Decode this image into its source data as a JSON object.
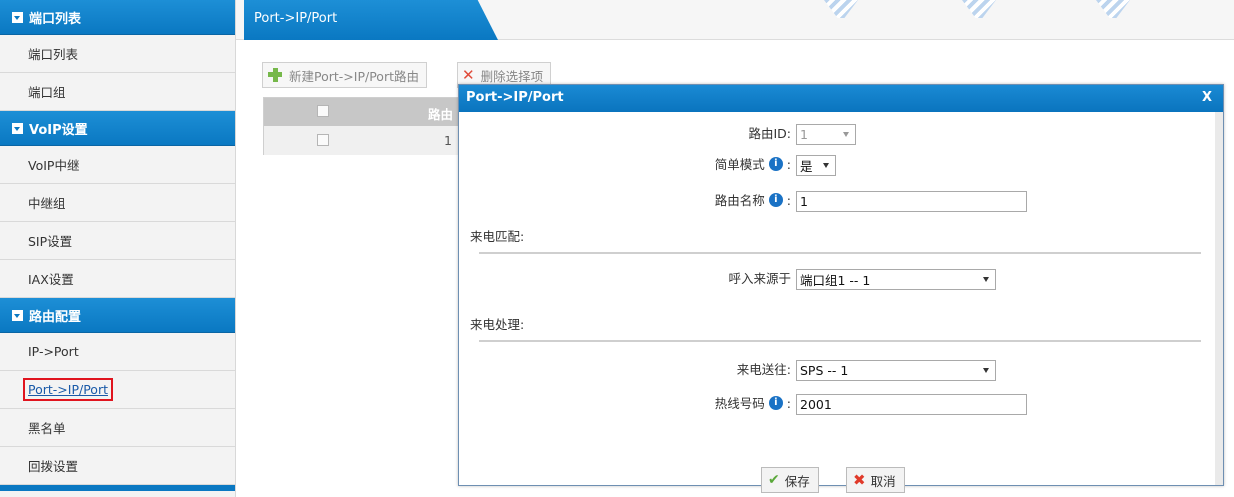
{
  "sidebar": {
    "sections": [
      {
        "title": "端口列表",
        "items": [
          "端口列表",
          "端口组"
        ]
      },
      {
        "title": "VoIP设置",
        "items": [
          "VoIP中继",
          "中继组",
          "SIP设置",
          "IAX设置"
        ]
      },
      {
        "title": "路由配置",
        "items": [
          "IP->Port",
          "Port->IP/Port",
          "黑名单",
          "回拨设置"
        ]
      }
    ],
    "active_item": "Port->IP/Port"
  },
  "tab": {
    "label": "Port->IP/Port"
  },
  "toolbar": {
    "new_label": "新建Port->IP/Port路由",
    "delete_label": "删除选择项"
  },
  "table": {
    "header_col": "路由",
    "rows": [
      {
        "id": "1"
      }
    ]
  },
  "dialog": {
    "title": "Port->IP/Port",
    "close": "X",
    "route_id_label": "路由ID:",
    "route_id_value": "1",
    "simple_mode_label": "简单模式",
    "simple_mode_value": "是",
    "route_name_label": "路由名称",
    "route_name_value": "1",
    "incoming_match_section": "来电匹配:",
    "call_source_label": "呼入来源于",
    "call_source_value": "端口组1 -- 1",
    "incoming_handling_section": "来电处理:",
    "send_to_label": "来电送往:",
    "send_to_value": "SPS -- 1",
    "hotline_label": "热线号码",
    "hotline_value": "2001",
    "info_glyph": "i",
    "colon": ":",
    "save_label": "保存",
    "cancel_label": "取消"
  }
}
